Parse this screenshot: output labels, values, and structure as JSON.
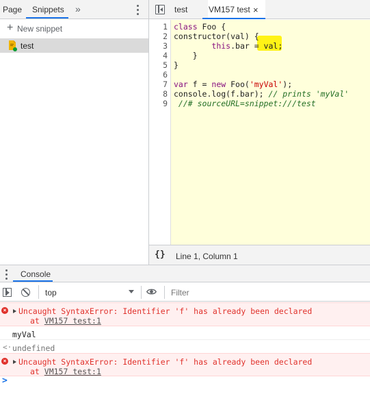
{
  "sources_panel": {
    "tabs": [
      {
        "label": "Page"
      },
      {
        "label": "Snippets"
      }
    ],
    "more_tabs_icon": "double-chevron-right",
    "new_snippet_label": "New snippet",
    "snippets": [
      {
        "label": "test"
      }
    ]
  },
  "editor": {
    "tabs": [
      {
        "label": "test"
      },
      {
        "label": "VM157 test"
      }
    ],
    "close_glyph": "×",
    "line_numbers": [
      "1",
      "2",
      "3",
      "4",
      "5",
      "6",
      "7",
      "8",
      "9"
    ],
    "code": {
      "l1_kw": "class",
      "l1_rest": " Foo {",
      "l2": "constructor(val) {",
      "l3_indent": "        ",
      "l3_kw": "this",
      "l3_rest": ".bar = val;",
      "l4": "    }",
      "l5": "}",
      "l6": "",
      "l7_kw1": "var",
      "l7_mid": " f = ",
      "l7_kw2": "new",
      "l7_mid2": " Foo(",
      "l7_str": "'myVal'",
      "l7_end": ");",
      "l8_code": "console.log(f.bar); ",
      "l8_comment": "// prints 'myVal'",
      "l9_comment": " //# sourceURL=snippet:///test"
    },
    "highlight_color": "#fff200",
    "status": {
      "pretty_print": "{}",
      "cursor_position": "Line 1, Column 1"
    }
  },
  "drawer": {
    "tab_label": "Console",
    "toolbar": {
      "context_label": "top",
      "filter_placeholder": "Filter"
    },
    "messages": [
      {
        "type": "error",
        "text": "Uncaught SyntaxError: Identifier 'f' has already been declared",
        "at": "at ",
        "source": "VM157 test:1"
      },
      {
        "type": "log",
        "text": "myVal"
      },
      {
        "type": "result",
        "arrow": "<·",
        "text": "undefined"
      },
      {
        "type": "error",
        "text": "Uncaught SyntaxError: Identifier 'f' has already been declared",
        "at": "at ",
        "source": "VM157 test:1"
      }
    ],
    "prompt_glyph": ">"
  },
  "colors": {
    "accent": "#1a73e8",
    "error": "#e0312b",
    "editor_background": "#ffffdb"
  }
}
